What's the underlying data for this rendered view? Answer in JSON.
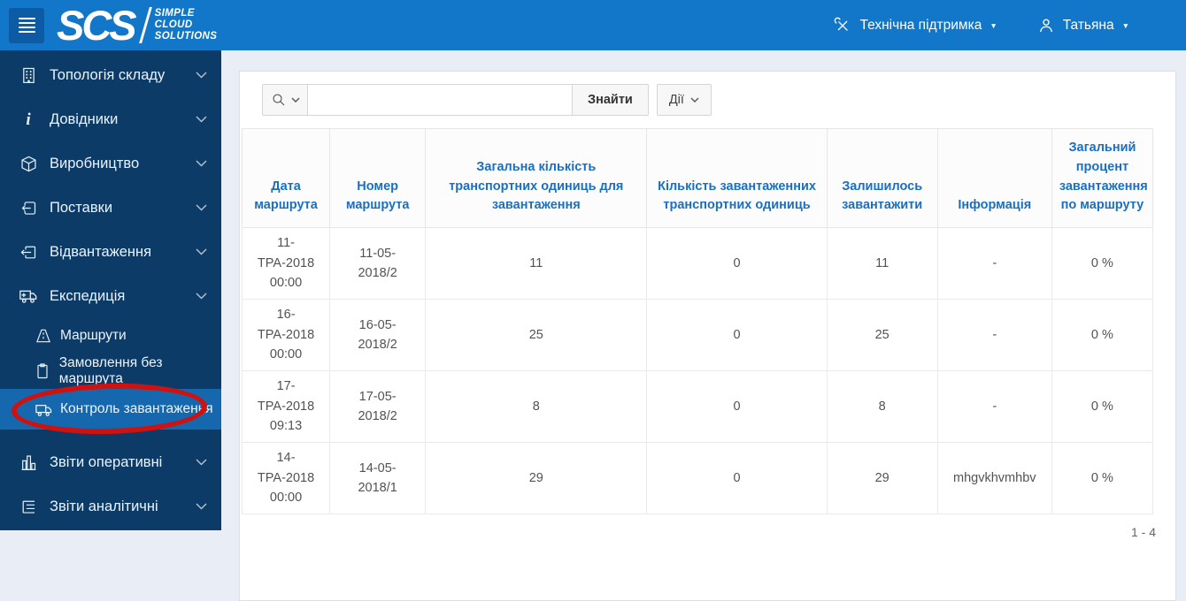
{
  "header": {
    "logo": {
      "name": "SCS",
      "tagline": [
        "SIMPLE",
        "CLOUD",
        "SOLUTIONS"
      ]
    },
    "support_label": "Технічна підтримка",
    "user_label": "Татьяна"
  },
  "sidebar": {
    "items": [
      {
        "label": "Топологія складу",
        "icon": "building-icon"
      },
      {
        "label": "Довідники",
        "icon": "info-icon"
      },
      {
        "label": "Виробництво",
        "icon": "production-box-icon"
      },
      {
        "label": "Поставки",
        "icon": "inbound-arrow-icon"
      },
      {
        "label": "Відвантаження",
        "icon": "outbound-arrow-icon"
      },
      {
        "label": "Експедиція",
        "icon": "expedition-truck-icon",
        "expanded": true
      }
    ],
    "subitems": [
      {
        "label": "Маршрути",
        "icon": "route-icon"
      },
      {
        "label": "Замовлення без маршрута",
        "icon": "clipboard-icon"
      },
      {
        "label": "Контроль завантаження",
        "icon": "truck-icon",
        "active": true
      }
    ],
    "items_bottom": [
      {
        "label": "Звіти оперативні",
        "icon": "bar-chart-icon"
      },
      {
        "label": "Звіти аналітичні",
        "icon": "report-lines-icon"
      }
    ]
  },
  "toolbar": {
    "search_value": "",
    "find_label": "Знайти",
    "actions_label": "Дії"
  },
  "table": {
    "columns": [
      "Дата маршрута",
      "Номер маршрута",
      "Загальна кількість транспортних одиниць для завантаження",
      "Кількість завантаженних транспортних одиниць",
      "Залишилось завантажити",
      "Інформація",
      "Загальний процент завантаження по маршруту"
    ],
    "rows": [
      [
        "11-\nТРА-2018\n00:00",
        "11-05-\n2018/2",
        "11",
        "0",
        "11",
        "-",
        "0 %"
      ],
      [
        "16-\nТРА-2018\n00:00",
        "16-05-\n2018/2",
        "25",
        "0",
        "25",
        "-",
        "0 %"
      ],
      [
        "17-\nТРА-2018\n09:13",
        "17-05-\n2018/2",
        "8",
        "0",
        "8",
        "-",
        "0 %"
      ],
      [
        "14-\nТРА-2018\n00:00",
        "14-05-\n2018/1",
        "29",
        "0",
        "29",
        "mhgvkhvmhbv",
        "0 %"
      ]
    ]
  },
  "pagination": {
    "label": "1 - 4"
  },
  "colors": {
    "header_bg": "#1277c8",
    "hamburger_bg": "#0d5ba5",
    "sidebar_bg": "#0c3b68",
    "active_item_bg": "#1568ad",
    "annotation_red": "#cf1110",
    "content_bg": "#e9eef6",
    "link_blue": "#1b6fc1"
  }
}
